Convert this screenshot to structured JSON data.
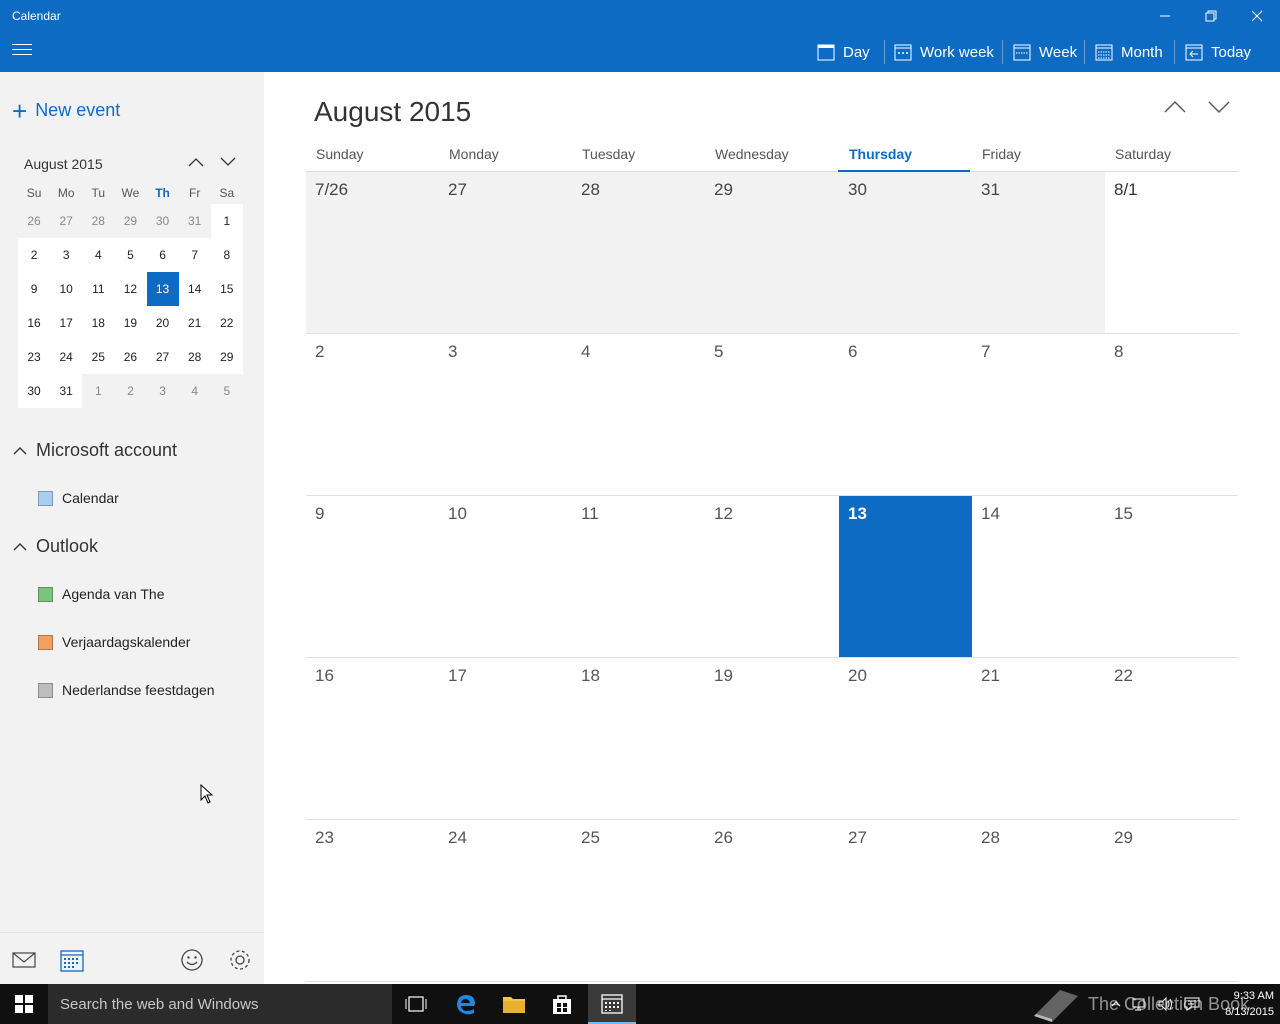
{
  "app": {
    "title": "Calendar"
  },
  "toolbar": {
    "views": [
      {
        "label": "Day",
        "icon": "day-icon"
      },
      {
        "label": "Work week",
        "icon": "workweek-icon"
      },
      {
        "label": "Week",
        "icon": "week-icon"
      },
      {
        "label": "Month",
        "icon": "month-icon"
      },
      {
        "label": "Today",
        "icon": "today-icon"
      }
    ]
  },
  "sidebar": {
    "new_event": "New event",
    "mini_calendar": {
      "title": "August 2015",
      "weekdays": [
        "Su",
        "Mo",
        "Tu",
        "We",
        "Th",
        "Fr",
        "Sa"
      ],
      "weeks": [
        [
          "26",
          "27",
          "28",
          "29",
          "30",
          "31",
          "1"
        ],
        [
          "2",
          "3",
          "4",
          "5",
          "6",
          "7",
          "8"
        ],
        [
          "9",
          "10",
          "11",
          "12",
          "13",
          "14",
          "15"
        ],
        [
          "16",
          "17",
          "18",
          "19",
          "20",
          "21",
          "22"
        ],
        [
          "23",
          "24",
          "25",
          "26",
          "27",
          "28",
          "29"
        ],
        [
          "30",
          "31",
          "1",
          "2",
          "3",
          "4",
          "5"
        ]
      ],
      "selected": "13"
    },
    "accounts": [
      {
        "name": "Microsoft account",
        "calendars": [
          {
            "name": "Calendar",
            "color": "#a9cdf0"
          }
        ]
      },
      {
        "name": "Outlook",
        "calendars": [
          {
            "name": "Agenda van The",
            "color": "#7cc47c"
          },
          {
            "name": "Verjaardagskalender",
            "color": "#f0a060"
          },
          {
            "name": "Nederlandse feestdagen",
            "color": "#bdbdbd"
          }
        ]
      }
    ]
  },
  "main": {
    "month_title": "August 2015",
    "weekdays": [
      "Sunday",
      "Monday",
      "Tuesday",
      "Wednesday",
      "Thursday",
      "Friday",
      "Saturday"
    ],
    "today_weekday": "Thursday",
    "weeks": [
      [
        "7/26",
        "27",
        "28",
        "29",
        "30",
        "31",
        "8/1"
      ],
      [
        "2",
        "3",
        "4",
        "5",
        "6",
        "7",
        "8"
      ],
      [
        "9",
        "10",
        "11",
        "12",
        "13",
        "14",
        "15"
      ],
      [
        "16",
        "17",
        "18",
        "19",
        "20",
        "21",
        "22"
      ],
      [
        "23",
        "24",
        "25",
        "26",
        "27",
        "28",
        "29"
      ]
    ],
    "selected_day": "13"
  },
  "taskbar": {
    "search_placeholder": "Search the web and Windows",
    "watermark": "The Collection Book",
    "time": "9:33 AM",
    "date": "8/13/2015"
  },
  "colors": {
    "accent": "#0d6bc4",
    "sidebar_bg": "#f2f2f2",
    "taskbar_bg": "#101010"
  }
}
